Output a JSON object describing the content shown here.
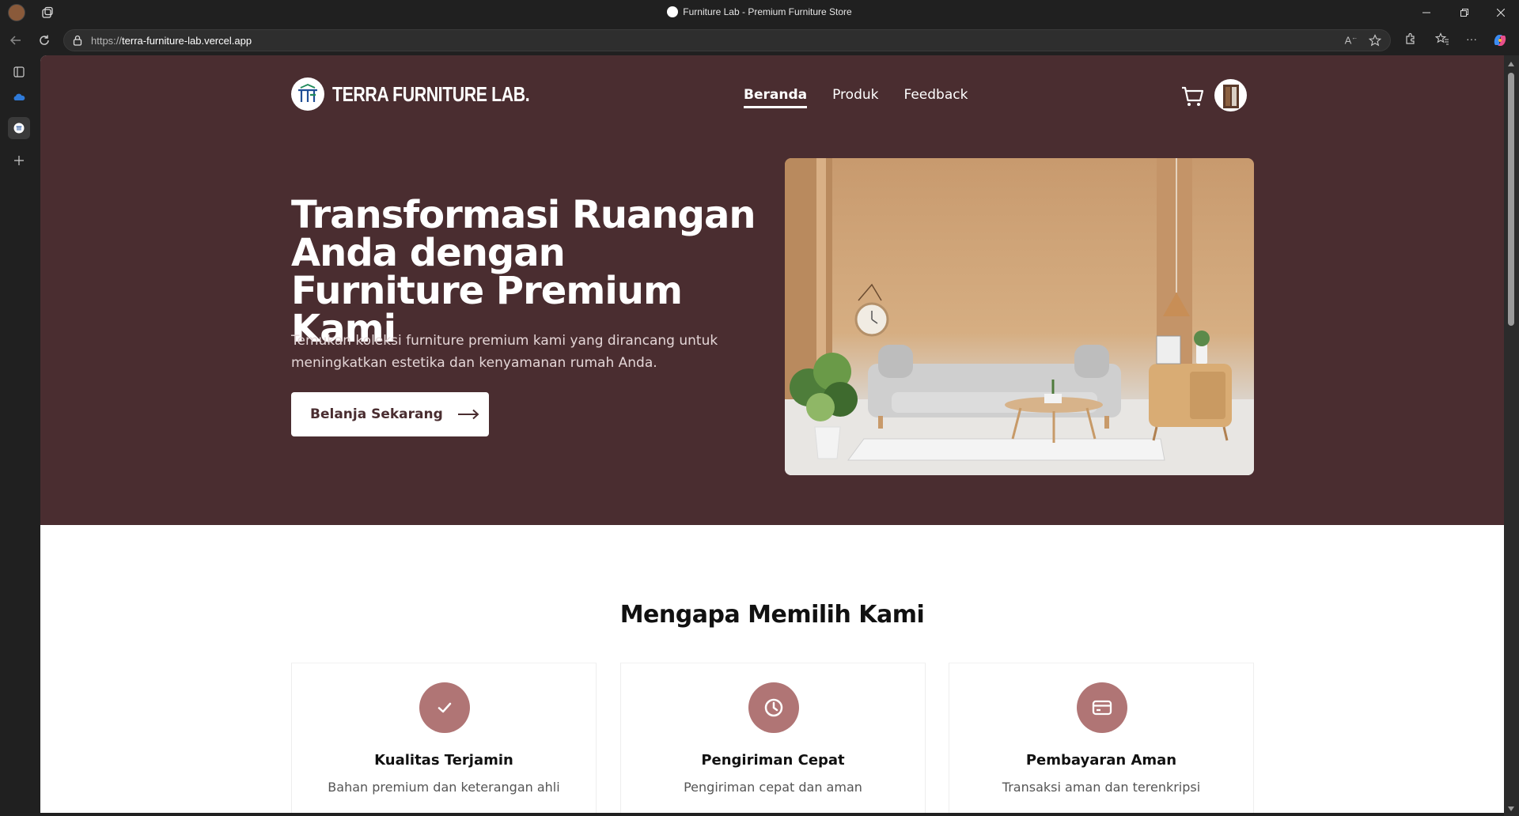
{
  "browser": {
    "tab_title": "Furniture Lab - Premium Furniture Store",
    "url_protocol": "https://",
    "url_host": "terra-furniture-lab.vercel.app"
  },
  "site": {
    "brand": "TERRA FURNITURE LAB.",
    "nav": [
      {
        "label": "Beranda",
        "active": true
      },
      {
        "label": "Produk",
        "active": false
      },
      {
        "label": "Feedback",
        "active": false
      }
    ]
  },
  "hero": {
    "title": "Transformasi Ruangan Anda dengan Furniture Premium Kami",
    "subtitle": "Temukan koleksi furniture premium kami yang dirancang untuk meningkatkan estetika dan kenyamanan rumah Anda.",
    "cta_label": "Belanja Sekarang"
  },
  "why": {
    "title": "Mengapa Memilih Kami",
    "features": [
      {
        "icon": "check-icon",
        "title": "Kualitas Terjamin",
        "desc": "Bahan premium dan keterangan ahli"
      },
      {
        "icon": "clock-icon",
        "title": "Pengiriman Cepat",
        "desc": "Pengiriman cepat dan aman"
      },
      {
        "icon": "credit-card-icon",
        "title": "Pembayaran Aman",
        "desc": "Transaksi aman dan terenkripsi"
      }
    ]
  },
  "colors": {
    "hero_bg": "#4a2d30",
    "accent": "#b07575",
    "page_bg": "#ffffff"
  }
}
